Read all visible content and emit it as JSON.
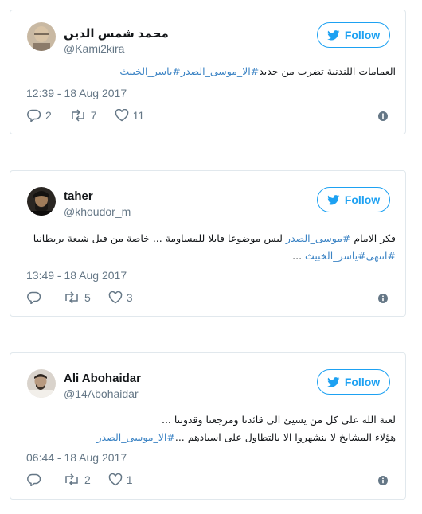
{
  "follow_label": "Follow",
  "colors": {
    "accent": "#1da1f2",
    "hashtag": "#3b83c4",
    "muted": "#657786",
    "border": "#e1e8ed"
  },
  "tweets": [
    {
      "name": "محمد شمس الدين",
      "handle": "@Kami2kira",
      "text_plain": "العمامات اللندنية تضرب من جديد",
      "hashtags": [
        "#الا_موسى_الصدر",
        "#ياسر_الخبيث"
      ],
      "timestamp": "12:39 - 18 Aug 2017",
      "replies": "2",
      "retweets": "7",
      "likes": "11"
    },
    {
      "name": "taher",
      "handle": "@khoudor_m",
      "line1_pre": "فكر الامام ",
      "line1_tag": "#موسى_الصدر",
      "line1_post": " ليس موضوعا قابلا للمساومة ... خاصة من قبل شيعة بريطانيا",
      "line2_tags": [
        "#انتهى",
        "#ياسر_الخبيث"
      ],
      "line2_suffix": " ...",
      "timestamp": "13:49 - 18 Aug 2017",
      "replies": "",
      "retweets": "5",
      "likes": "3"
    },
    {
      "name": "Ali Abohaidar",
      "handle": "@14Abohaidar",
      "line1": "لعنة الله على كل من يسيئ الى قائدنا ومرجعنا وقدوتنا ...",
      "line2_pre": "هؤلاء المشايخ لا ينشهروا الا بالتطاول على اسيادهم ...",
      "line2_tag": "#الا_موسى_الصدر",
      "timestamp": "06:44 - 18 Aug 2017",
      "replies": "",
      "retweets": "2",
      "likes": "1"
    }
  ]
}
